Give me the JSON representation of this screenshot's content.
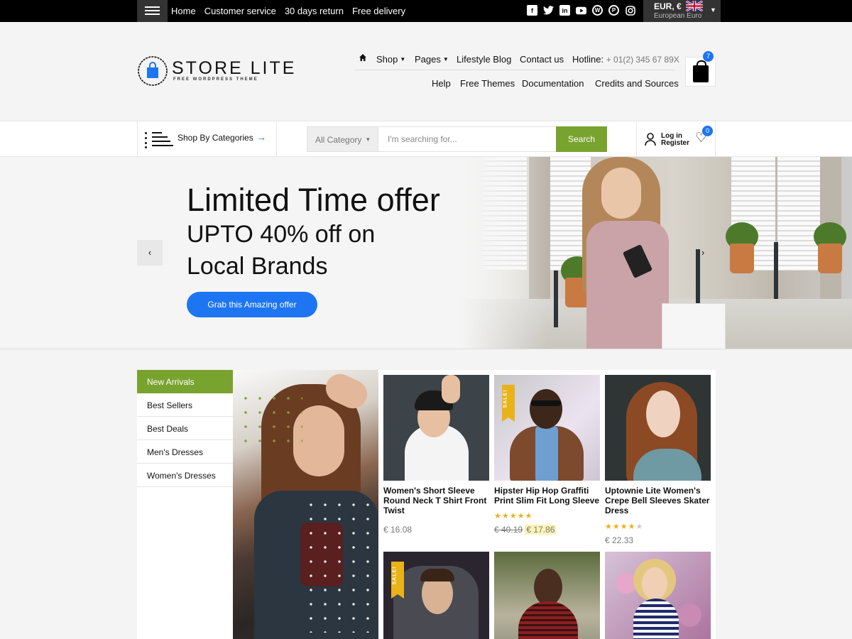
{
  "topbar": {
    "links": [
      "Home",
      "Customer service",
      "30 days return",
      "Free delivery"
    ],
    "socials": [
      "facebook-icon",
      "twitter-icon",
      "linkedin-icon",
      "youtube-icon",
      "wordpress-icon",
      "pinterest-icon",
      "instagram-icon"
    ],
    "currency": {
      "code": "EUR, €",
      "name": "European Euro",
      "flag": "uk-flag-icon"
    }
  },
  "logo": {
    "title": "STORE LITE",
    "subtitle": "FREE WORDPRESS THEME"
  },
  "nav": {
    "shop": "Shop",
    "pages": "Pages",
    "blog": "Lifestyle Blog",
    "contact": "Contact us",
    "hotline_label": "Hotline:",
    "hotline_number": "+ 01(2) 345 67 89X",
    "sub": [
      "Help",
      "Free Themes",
      "Documentation",
      "Credits and Sources"
    ],
    "cart_count": "7"
  },
  "catbar": {
    "shop_by": "Shop By Categories",
    "search_category": "All Category",
    "search_placeholder": "I'm searching for...",
    "search_button": "Search",
    "login": "Log in",
    "register": "Register",
    "wishlist_count": "0"
  },
  "hero": {
    "title": "Limited Time offer",
    "line1": "UPTO 40% off on",
    "line2": "Local Brands",
    "cta": "Grab this Amazing offer"
  },
  "tabs": [
    "New Arrivals",
    "Best Sellers",
    "Best Deals",
    "Men's Dresses",
    "Women's Dresses"
  ],
  "products": [
    {
      "name": "Women's Short Sleeve Round Neck T Shirt Front Twist",
      "price": "€ 16.08",
      "rating": 0,
      "sale": false
    },
    {
      "name": "Hipster Hip Hop Graffiti Print Slim Fit Long Sleeve",
      "price_old": "€ 40.19",
      "price": "€ 17.86",
      "rating": 5,
      "sale": true,
      "sale_label": "SALE!"
    },
    {
      "name": "Uptownie Lite Women's Crepe Bell Sleeves Skater Dress",
      "price": "€ 22.33",
      "rating": 3.5,
      "sale": false
    },
    {
      "sale": true,
      "sale_label": "SALE!"
    },
    {
      "sale": false
    },
    {
      "sale": false
    }
  ],
  "colors": {
    "accent_blue": "#1d75f2",
    "accent_green": "#79a32f",
    "sale_yellow": "#e9b219"
  }
}
